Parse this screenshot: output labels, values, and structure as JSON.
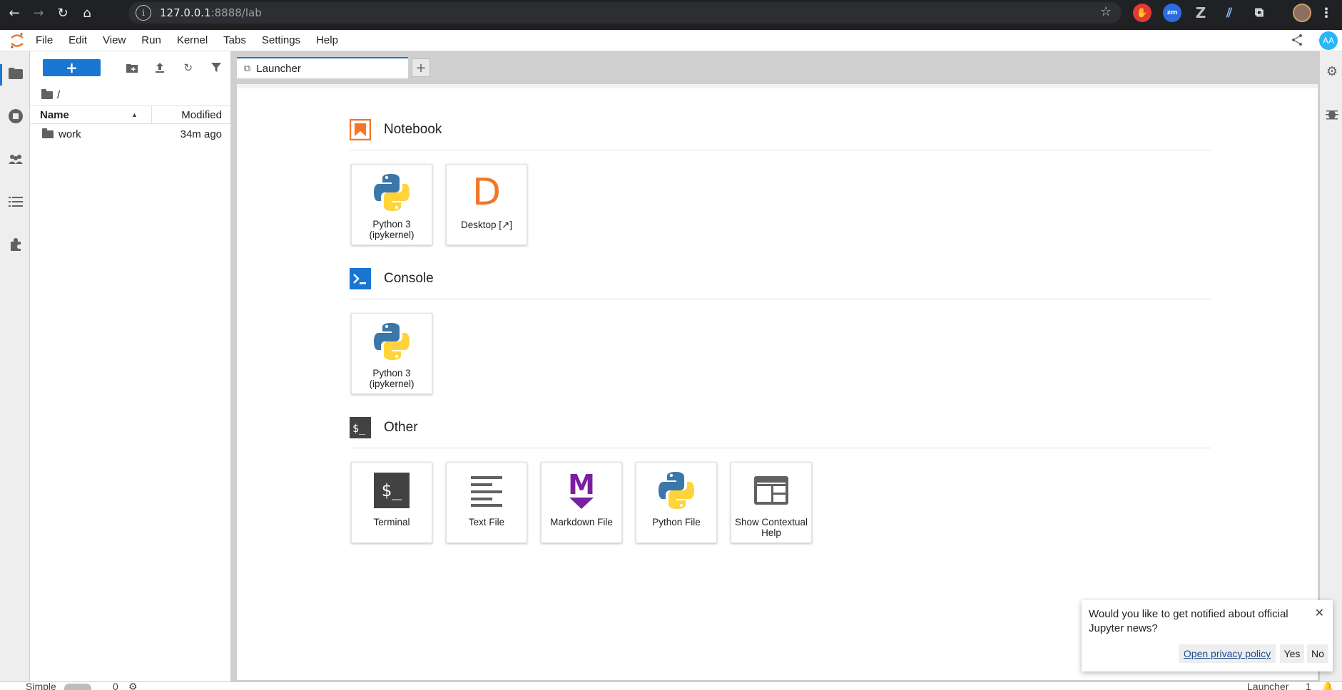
{
  "browser": {
    "url_host": "127.0.0.1",
    "url_rest": ":8888/lab",
    "extensions": [
      {
        "name": "adblock-extension",
        "glyph": "✋",
        "color": "#e53935"
      },
      {
        "name": "zoom-extension",
        "glyph": "zm",
        "color": "#2d6cdf"
      },
      {
        "name": "z-extension",
        "glyph": "Z",
        "color": "#9e9e9e"
      },
      {
        "name": "ai-extension",
        "glyph": "⫽",
        "color": "#8ab4f8"
      }
    ]
  },
  "menubar": {
    "items": [
      "File",
      "Edit",
      "View",
      "Run",
      "Kernel",
      "Tabs",
      "Settings",
      "Help"
    ],
    "user_initials": "AA"
  },
  "filebrowser": {
    "new_label": "+",
    "breadcrumb": "/",
    "columns": {
      "name": "Name",
      "modified": "Modified"
    },
    "rows": [
      {
        "name": "work",
        "modified": "34m ago"
      }
    ]
  },
  "tabs": [
    {
      "label": "Launcher"
    }
  ],
  "launcher": {
    "sections": [
      {
        "title": "Notebook",
        "cards": [
          {
            "label": "Python 3 (ipykernel)",
            "icon": "python-icon"
          },
          {
            "label": "Desktop [↗]",
            "icon": "desktop-d-icon"
          }
        ]
      },
      {
        "title": "Console",
        "cards": [
          {
            "label": "Python 3 (ipykernel)",
            "icon": "python-icon"
          }
        ]
      },
      {
        "title": "Other",
        "cards": [
          {
            "label": "Terminal",
            "icon": "terminal-icon"
          },
          {
            "label": "Text File",
            "icon": "text-file-icon"
          },
          {
            "label": "Markdown File",
            "icon": "markdown-icon"
          },
          {
            "label": "Python File",
            "icon": "python-icon"
          },
          {
            "label": "Show Contextual Help",
            "icon": "contextual-help-icon"
          }
        ]
      }
    ],
    "desktop_letter": "D",
    "markdown_letter": "M",
    "terminal_text": "$_"
  },
  "notification": {
    "message": "Would you like to get notified about official Jupyter news?",
    "privacy_link": "Open privacy policy",
    "yes_label": "Yes",
    "no_label": "No"
  },
  "statusbar": {
    "mode_label": "Simple",
    "kernel_count": "0",
    "right_label": "Launcher",
    "right_count": "1"
  },
  "colors": {
    "accent": "#1976d2",
    "notebook_orange": "#f37626",
    "markdown_purple": "#7b1fa2",
    "python_blue": "#3b77a8",
    "python_yellow": "#ffd43b"
  }
}
